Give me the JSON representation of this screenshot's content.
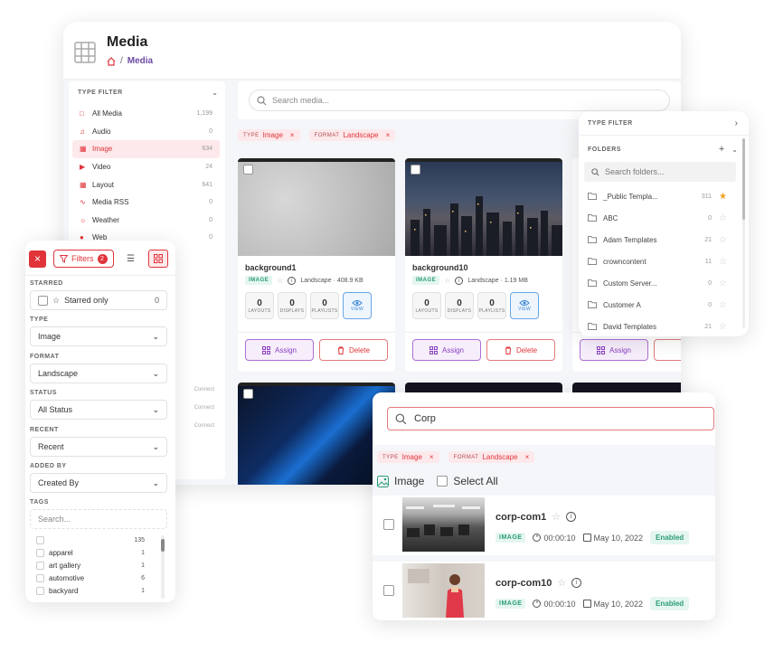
{
  "main": {
    "title": "Media",
    "breadcrumb": "Media",
    "search_placeholder": "Search media...",
    "chips": [
      {
        "k": "TYPE",
        "v": "Image"
      },
      {
        "k": "FORMAT",
        "v": "Landscape"
      }
    ],
    "type_filter_label": "TYPE FILTER",
    "types": [
      {
        "label": "All Media",
        "count": "1,199"
      },
      {
        "label": "Audio",
        "count": "0"
      },
      {
        "label": "Image",
        "count": "634"
      },
      {
        "label": "Video",
        "count": "24"
      },
      {
        "label": "Layout",
        "count": "641"
      },
      {
        "label": "Media RSS",
        "count": "0"
      },
      {
        "label": "Weather",
        "count": "0"
      },
      {
        "label": "Web",
        "count": "0"
      }
    ],
    "connect_labels": [
      "Connect",
      "Connect",
      "Connect"
    ],
    "cards": [
      {
        "name": "background1",
        "badge": "IMAGE",
        "meta": "Landscape · 408.9 KB",
        "stats": [
          {
            "v": "0",
            "l": "LAYOUTS"
          },
          {
            "v": "0",
            "l": "DISPLAYS"
          },
          {
            "v": "0",
            "l": "PLAYLISTS"
          }
        ],
        "view": "VIEW",
        "assign": "Assign",
        "delete": "Delete"
      },
      {
        "name": "background10",
        "badge": "IMAGE",
        "meta": "Landscape · 1.19 MB",
        "stats": [
          {
            "v": "0",
            "l": "LAYOUTS"
          },
          {
            "v": "0",
            "l": "DISPLAYS"
          },
          {
            "v": "0",
            "l": "PLAYLISTS"
          }
        ],
        "view": "VIEW",
        "assign": "Assign",
        "delete": "Delete"
      },
      {
        "assign": "Assign"
      }
    ]
  },
  "filters": {
    "label": "Filters",
    "count": "2",
    "starred_label": "STARRED",
    "starred_only": "Starred only",
    "starred_count": "0",
    "type_label": "TYPE",
    "type_value": "Image",
    "format_label": "FORMAT",
    "format_value": "Landscape",
    "status_label": "STATUS",
    "status_value": "All Status",
    "recent_label": "RECENT",
    "recent_value": "Recent",
    "added_label": "ADDED BY",
    "added_value": "Created By",
    "tags_label": "TAGS",
    "tags_placeholder": "Search...",
    "tags": [
      {
        "label": "",
        "count": "135"
      },
      {
        "label": "apparel",
        "count": "1"
      },
      {
        "label": "art gallery",
        "count": "1"
      },
      {
        "label": "automotive",
        "count": "6"
      },
      {
        "label": "backyard",
        "count": "1"
      }
    ]
  },
  "folders": {
    "type_filter_label": "TYPE FILTER",
    "folders_label": "FOLDERS",
    "search_placeholder": "Search folders...",
    "items": [
      {
        "label": "_Public Templa...",
        "count": "311",
        "star": true
      },
      {
        "label": "ABC",
        "count": "0"
      },
      {
        "label": "Adam Templates",
        "count": "21"
      },
      {
        "label": "crowncontent",
        "count": "11"
      },
      {
        "label": "Custom Server...",
        "count": "0"
      },
      {
        "label": "Customer A",
        "count": "0"
      },
      {
        "label": "David Templates",
        "count": "21"
      }
    ]
  },
  "search": {
    "query": "Corp",
    "chips": [
      {
        "k": "TYPE",
        "v": "Image"
      },
      {
        "k": "FORMAT",
        "v": "Landscape"
      }
    ],
    "group": "Image",
    "select_all": "Select All",
    "results": [
      {
        "name": "corp-com1",
        "badge": "IMAGE",
        "duration": "00:00:10",
        "date": "May 10, 2022",
        "status": "Enabled"
      },
      {
        "name": "corp-com10",
        "badge": "IMAGE",
        "duration": "00:00:10",
        "date": "May 10, 2022",
        "status": "Enabled"
      }
    ]
  },
  "colors": {
    "accent": "#e0343a",
    "purple": "#8b3fc0",
    "green": "#2b9c77"
  }
}
